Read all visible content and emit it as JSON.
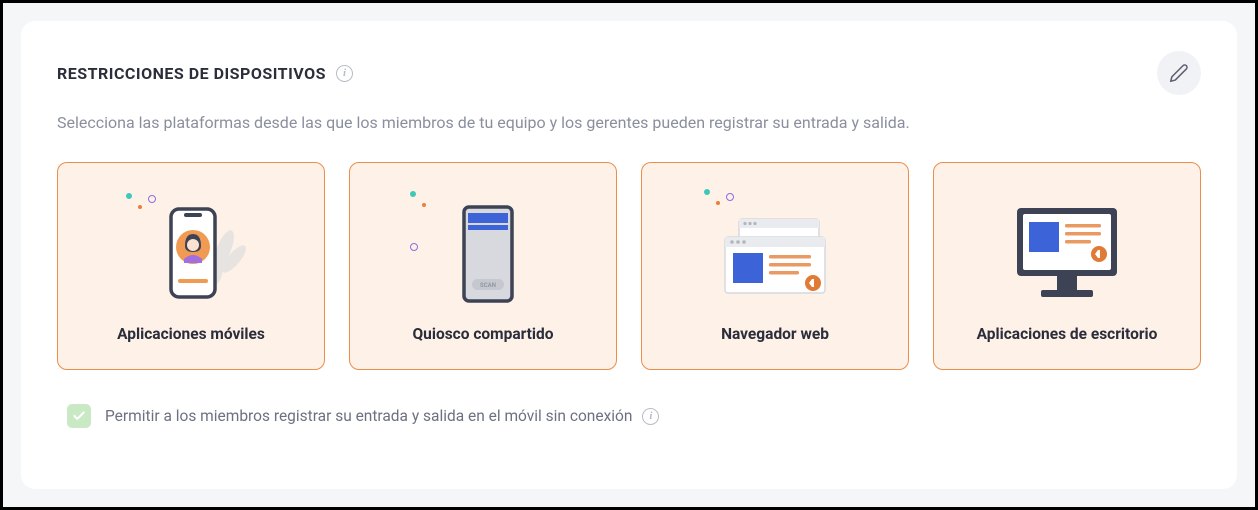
{
  "header": {
    "title": "RESTRICCIONES DE DISPOSITIVOS"
  },
  "subtitle": "Selecciona las plataformas desde las que los miembros de tu equipo y los gerentes pueden registrar su entrada y salida.",
  "options": [
    {
      "label": "Aplicaciones móviles"
    },
    {
      "label": "Quiosco compartido"
    },
    {
      "label": "Navegador web"
    },
    {
      "label": "Aplicaciones de escritorio"
    }
  ],
  "offline": {
    "label": "Permitir a los miembros registrar su entrada y salida en el móvil sin conexión",
    "checked": true
  }
}
